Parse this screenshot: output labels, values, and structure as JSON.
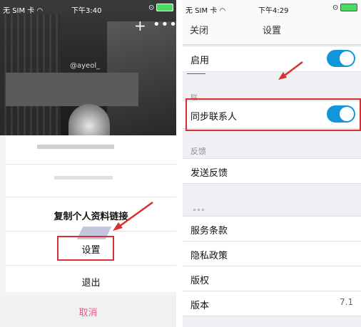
{
  "left": {
    "status": {
      "carrier": "无 SIM 卡",
      "wifi_icon": "wifi-icon",
      "time": "下午3:40",
      "right": "⊙"
    },
    "header": {
      "add_icon": "+",
      "more_icon": "•••"
    },
    "profile": {
      "handle": "@ayeol_"
    },
    "menu": {
      "copy_link": "复制个人资料链接",
      "settings": "设置",
      "logout": "退出",
      "cancel": "取消"
    }
  },
  "right": {
    "status": {
      "carrier": "无 SIM 卡",
      "wifi_icon": "wifi-icon",
      "time": "下午4:29",
      "right": "⊙"
    },
    "nav": {
      "close": "关闭",
      "title": "设置"
    },
    "cells": {
      "enable": "启用",
      "sync_contacts": "同步联系人",
      "feedback_section": "反馈",
      "send_feedback": "发送反馈",
      "terms": "服务条款",
      "privacy": "隐私政策",
      "copyright": "版权",
      "version_label": "版本",
      "version_value": "7.1"
    },
    "toggles": {
      "enable": true,
      "sync_contacts": true
    },
    "section_fragment": "联"
  },
  "colors": {
    "accent_pink": "#e85a93",
    "toggle_blue": "#1296db",
    "highlight_red": "#d63030"
  }
}
